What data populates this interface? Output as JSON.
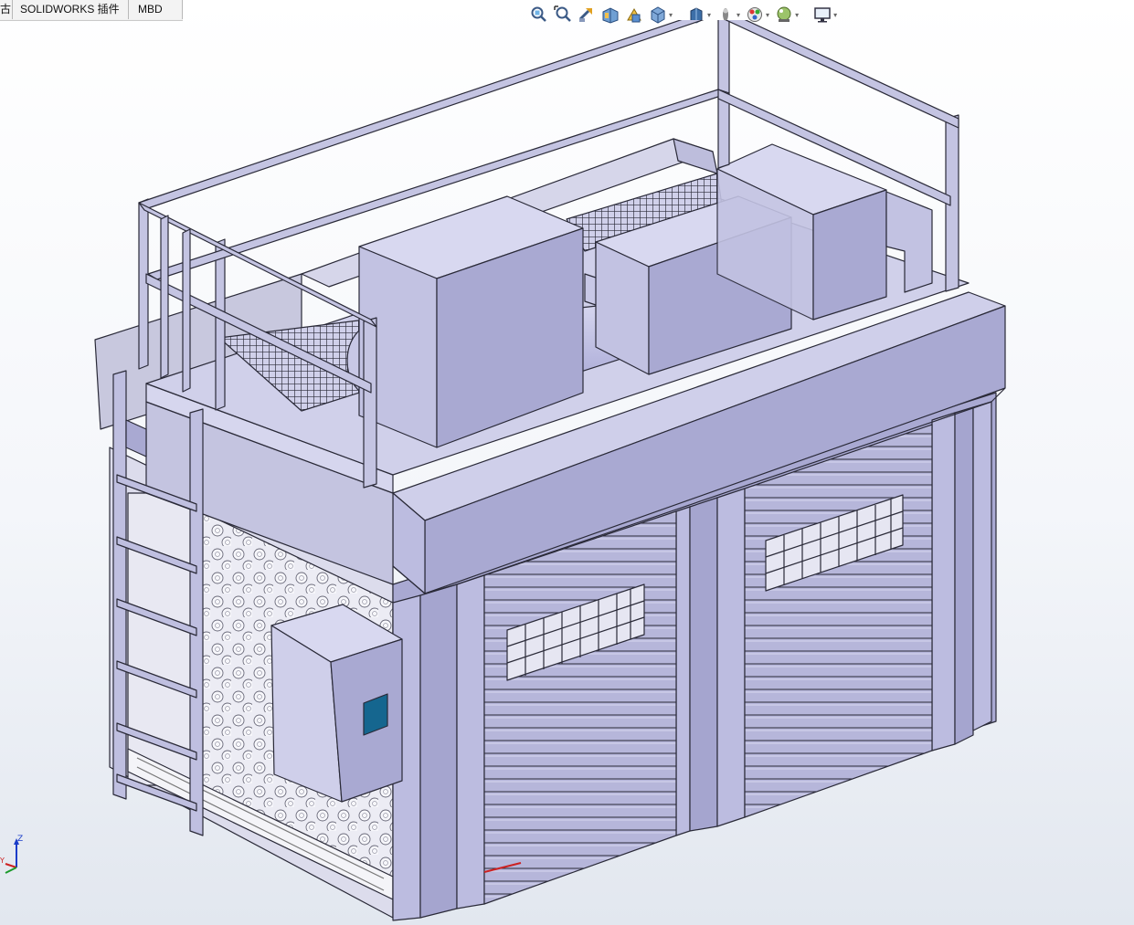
{
  "command_manager": {
    "tabs": [
      {
        "label": "古"
      },
      {
        "label": "SOLIDWORKS 插件"
      },
      {
        "label": "MBD"
      }
    ]
  },
  "heads_up_toolbar": {
    "buttons": [
      {
        "icon": "zoom-to-fit-icon"
      },
      {
        "icon": "zoom-to-area-icon"
      },
      {
        "icon": "previous-view-icon"
      },
      {
        "icon": "section-view-icon"
      },
      {
        "icon": "dynamic-annotation-views-icon"
      },
      {
        "icon": "view-orientation-icon"
      },
      {
        "icon": "display-style-icon"
      },
      {
        "icon": "hide-show-items-icon"
      },
      {
        "icon": "edit-appearance-icon"
      },
      {
        "icon": "apply-scene-icon"
      },
      {
        "icon": "view-settings-icon"
      }
    ]
  },
  "triad": {
    "z_label": "Z",
    "x_label": "X",
    "y_label": "Y"
  },
  "colors": {
    "model_face": "#b9b9dc",
    "model_face_dark": "#9d9dc6",
    "model_face_light": "#cfcfea",
    "edge": "#2a2a38",
    "panel_window": "#15668f",
    "accent_red": "#cc2222"
  }
}
